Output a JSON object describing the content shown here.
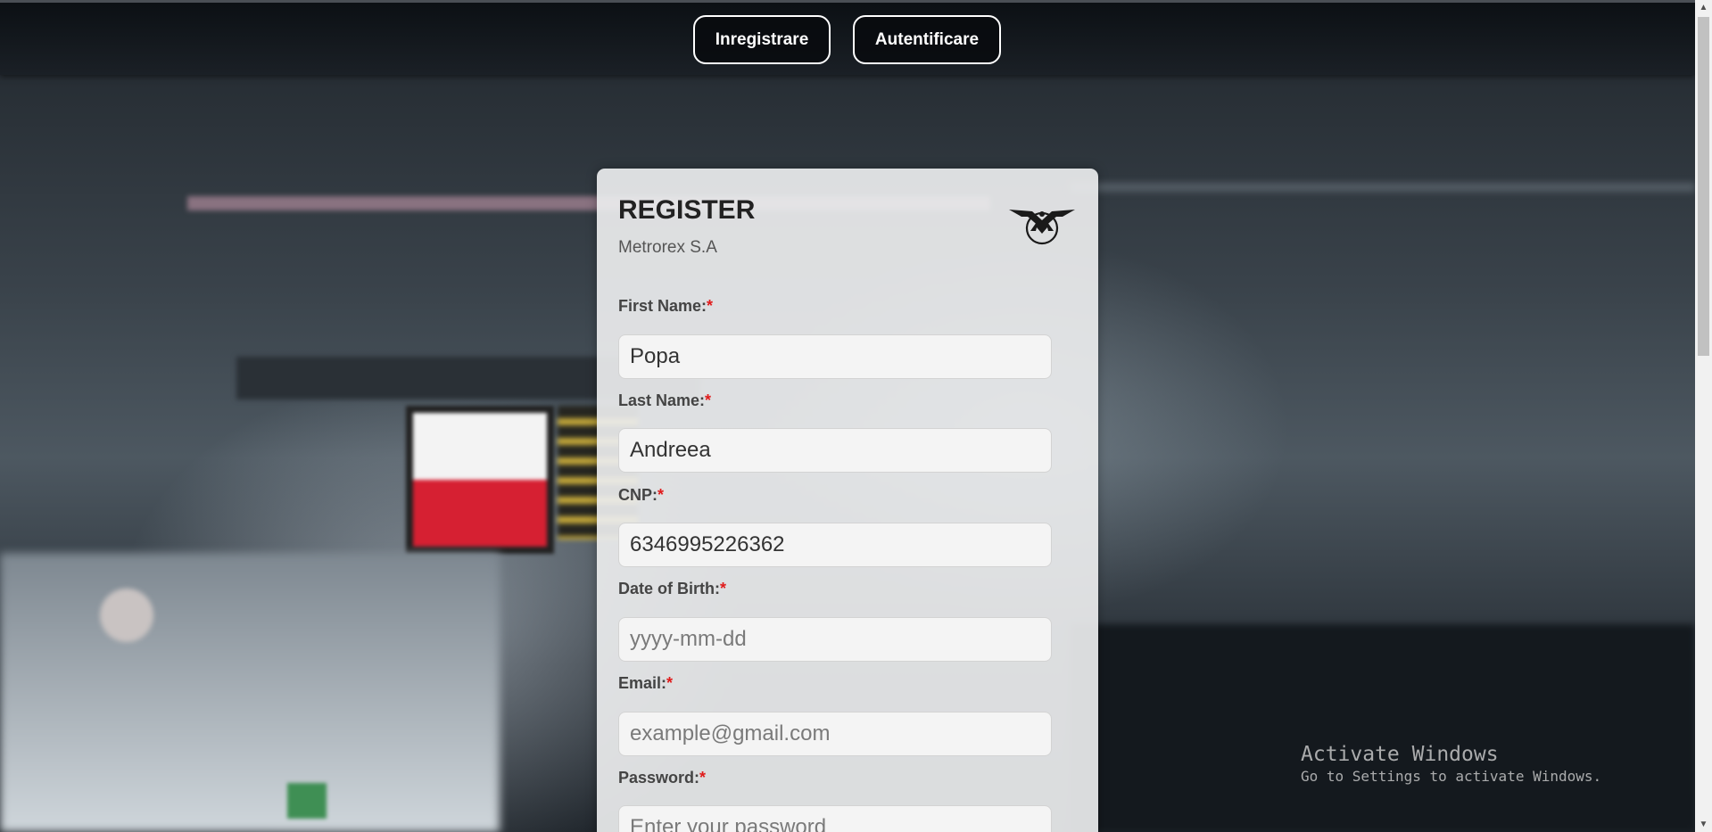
{
  "nav": {
    "register_label": "Inregistrare",
    "login_label": "Autentificare"
  },
  "card": {
    "title": "REGISTER",
    "subtitle": "Metrorex S.A",
    "logo_icon": "metrorex-logo-icon"
  },
  "form": {
    "required_mark": "*",
    "fields": [
      {
        "label": "First Name:",
        "value": "Popa",
        "placeholder": ""
      },
      {
        "label": "Last Name:",
        "value": "Andreea",
        "placeholder": ""
      },
      {
        "label": "CNP:",
        "value": "6346995226362",
        "placeholder": ""
      },
      {
        "label": "Date of Birth:",
        "value": "",
        "placeholder": "yyyy-mm-dd"
      },
      {
        "label": "Email:",
        "value": "",
        "placeholder": "example@gmail.com"
      },
      {
        "label": "Password:",
        "value": "",
        "placeholder": "Enter your password"
      }
    ]
  },
  "watermark": {
    "title": "Activate Windows",
    "subtitle": "Go to Settings to activate Windows."
  },
  "colors": {
    "required": "#e01b1b",
    "card_bg": "#ecedee",
    "nav_bg": "#0a0e12"
  }
}
